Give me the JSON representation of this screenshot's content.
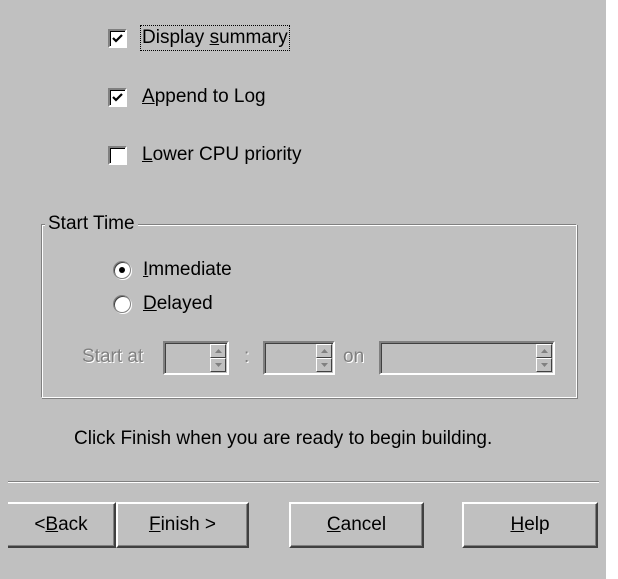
{
  "options": {
    "display_summary": {
      "label_pre": "Display ",
      "label_accel": "s",
      "label_post": "ummary",
      "checked": true
    },
    "append_to_log": {
      "label_pre": "",
      "label_accel": "A",
      "label_post": "ppend to Log",
      "checked": true
    },
    "lower_cpu": {
      "label_pre": "",
      "label_accel": "L",
      "label_post": "ower CPU priority",
      "checked": false
    }
  },
  "start_time": {
    "legend": "Start Time",
    "immediate": {
      "label_accel": "I",
      "label_post": "mmediate",
      "selected": true
    },
    "delayed": {
      "label_accel": "D",
      "label_post": "elayed",
      "selected": false
    },
    "start_at_label": "Start at",
    "colon": ":",
    "on_label": "on",
    "hour_value": "",
    "minute_value": "",
    "date_value": ""
  },
  "instruction": "Click Finish when you are ready to begin building.",
  "buttons": {
    "back": {
      "pre": "< ",
      "accel": "B",
      "post": "ack"
    },
    "finish": {
      "pre": "",
      "accel": "F",
      "post": "inish >"
    },
    "cancel": {
      "pre": "",
      "accel": "C",
      "post": "ancel"
    },
    "help": {
      "pre": "",
      "accel": "H",
      "post": "elp"
    }
  }
}
